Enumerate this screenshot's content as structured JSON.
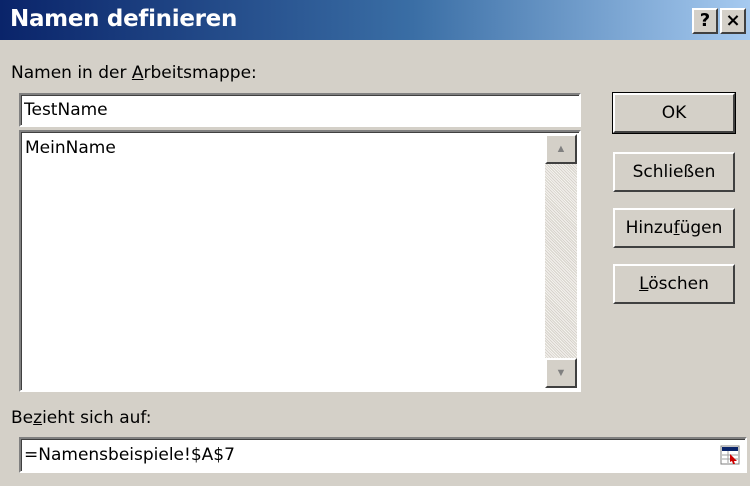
{
  "window": {
    "title": "Namen definieren",
    "help_label": "?",
    "close_label": "×"
  },
  "names_label": {
    "prefix": "Namen in der ",
    "accel": "A",
    "suffix": "rbeitsmappe:"
  },
  "name_input": {
    "value": "TestName"
  },
  "names_list": {
    "items": [
      "MeinName"
    ]
  },
  "scrollbar": {
    "up_arrow": "▲",
    "down_arrow": "▼"
  },
  "buttons": {
    "ok": "OK",
    "close": "Schließen",
    "add": {
      "prefix": "Hinzu",
      "accel": "f",
      "suffix": "ügen"
    },
    "delete": {
      "prefix": "",
      "accel": "L",
      "suffix": "öschen"
    }
  },
  "refers_label": {
    "prefix": "Be",
    "accel": "z",
    "suffix": "ieht sich auf:"
  },
  "refers_input": {
    "value": "=Namensbeispiele!$A$7"
  },
  "icons": {
    "range_picker": "range-picker-icon"
  },
  "colors": {
    "title_start": "#0a246a",
    "title_end": "#a6caf0",
    "face": "#d4d0c8"
  }
}
